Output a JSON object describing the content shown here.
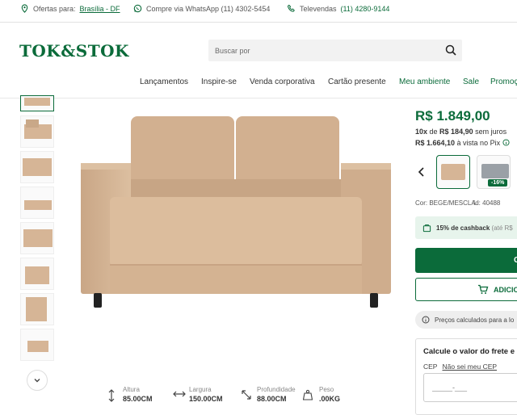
{
  "topbar": {
    "location_label": "Ofertas para:",
    "location_value": "Brasília - DF",
    "whatsapp": "Compre via WhatsApp (11) 4302-5454",
    "phone_label": "Televendas",
    "phone_value": "(11) 4280-9144"
  },
  "header": {
    "logo": "TOK&STOK",
    "search_placeholder": "Buscar por"
  },
  "nav": {
    "items": [
      "Lançamentos",
      "Inspire-se",
      "Venda corporativa",
      "Cartão presente",
      "Meu ambiente",
      "Sale",
      "Promoç"
    ]
  },
  "dimensions": {
    "height_label": "Altura",
    "height_value": "85.00CM",
    "width_label": "Largura",
    "width_value": "150.00CM",
    "depth_label": "Profundidade",
    "depth_value": "88.00CM",
    "weight_label": "Peso",
    "weight_value": ".00KG"
  },
  "product": {
    "price": "R$ 1.849,00",
    "installments_count": "10x",
    "installments_mid": " de ",
    "installments_value": "R$ 184,90",
    "installments_suffix": " sem juros",
    "pix_value": "R$ 1.664,10",
    "pix_suffix": " à vista no Pix",
    "discount_badge": "-16%",
    "color_label": "Cor: BEGE/MESCLA",
    "id_label": "Id: 40488",
    "cashback_bold": "15% de cashback",
    "cashback_rest": " (até R$",
    "buy_label": "C",
    "add_cart_label": "ADICIO",
    "price_notice": "Preços calculados para a lo",
    "freight_title": "Calcule o valor do frete e",
    "cep_label": "CEP",
    "cep_link": "Não sei meu CEP",
    "cep_placeholder": "_____-___"
  },
  "colors": {
    "brand": "#0b6b3a",
    "sofa": "#d6b596"
  }
}
